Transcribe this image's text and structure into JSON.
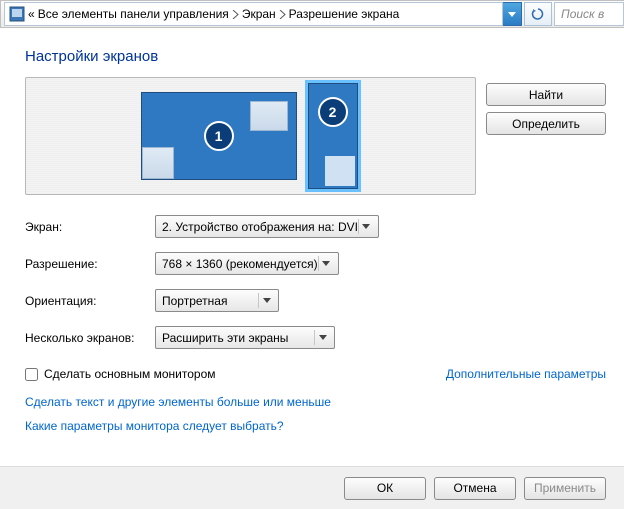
{
  "breadcrumb": {
    "back": "«",
    "items": [
      "Все элементы панели управления",
      "Экран",
      "Разрешение экрана"
    ],
    "search_placeholder": "Поиск в"
  },
  "title": "Настройки экранов",
  "monitors": {
    "m1": "1",
    "m2": "2"
  },
  "side": {
    "find": "Найти",
    "identify": "Определить"
  },
  "form": {
    "screen_lbl": "Экран:",
    "screen_val": "2. Устройство отображения на: DVI",
    "res_lbl": "Разрешение:",
    "res_val": "768 × 1360 (рекомендуется)",
    "orient_lbl": "Ориентация:",
    "orient_val": "Портретная",
    "multi_lbl": "Несколько экранов:",
    "multi_val": "Расширить эти экраны"
  },
  "chk_label": "Сделать основным монитором",
  "adv_link": "Дополнительные параметры",
  "link1": "Сделать текст и другие элементы больше или меньше",
  "link2": "Какие параметры монитора следует выбрать?",
  "footer": {
    "ok": "ОК",
    "cancel": "Отмена",
    "apply": "Применить"
  }
}
